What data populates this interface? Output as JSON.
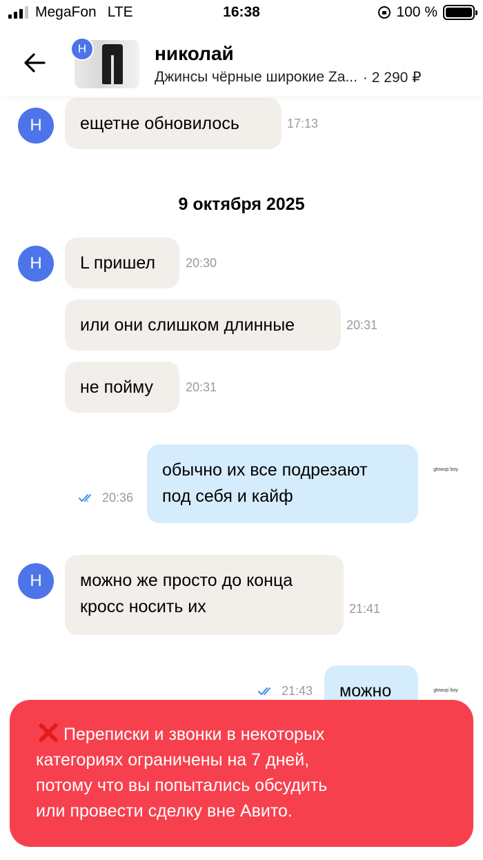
{
  "status_bar": {
    "carrier": "MegaFon",
    "network": "LTE",
    "time": "16:38",
    "battery": "100 %"
  },
  "header": {
    "avatar_letter": "Н",
    "name": "николай",
    "item_title": "Джинсы чёрные широкие Za...",
    "price": "· 2 290 ₽"
  },
  "chat": {
    "date_separator": "9 октября 2025",
    "messages": [
      {
        "text": "ещетне обновилось",
        "time": "17:13",
        "avatar": "Н"
      },
      {
        "text": "L пришел",
        "time": "20:30",
        "avatar": "Н"
      },
      {
        "text": "или они слишком длинные",
        "time": "20:31"
      },
      {
        "text": "не пойму",
        "time": "20:31"
      },
      {
        "line1": "обычно их все подрезают",
        "line2": "под себя и кайф",
        "time": "20:36",
        "logo": "glowup`boy"
      },
      {
        "line1": "можно же просто до конца",
        "line2": "кросс носить их",
        "time": "21:41",
        "avatar": "Н"
      },
      {
        "text": "можно",
        "time": "21:43",
        "logo": "glowup`boy"
      }
    ]
  },
  "notice": {
    "icon": "cross-mark-icon",
    "line1": "Переписки и звонки в некоторых",
    "line2": "категориях ограничены на 7 дней,",
    "line3": "потому что вы попытались обсудить",
    "line4": "или провести сделку вне Авито."
  },
  "colors": {
    "avatar": "#4d74e8",
    "incoming_bubble": "#f2efea",
    "outgoing_bubble": "#d5ecfd",
    "notice_bg": "#f7404e",
    "read_ticks": "#3b8ef0"
  }
}
